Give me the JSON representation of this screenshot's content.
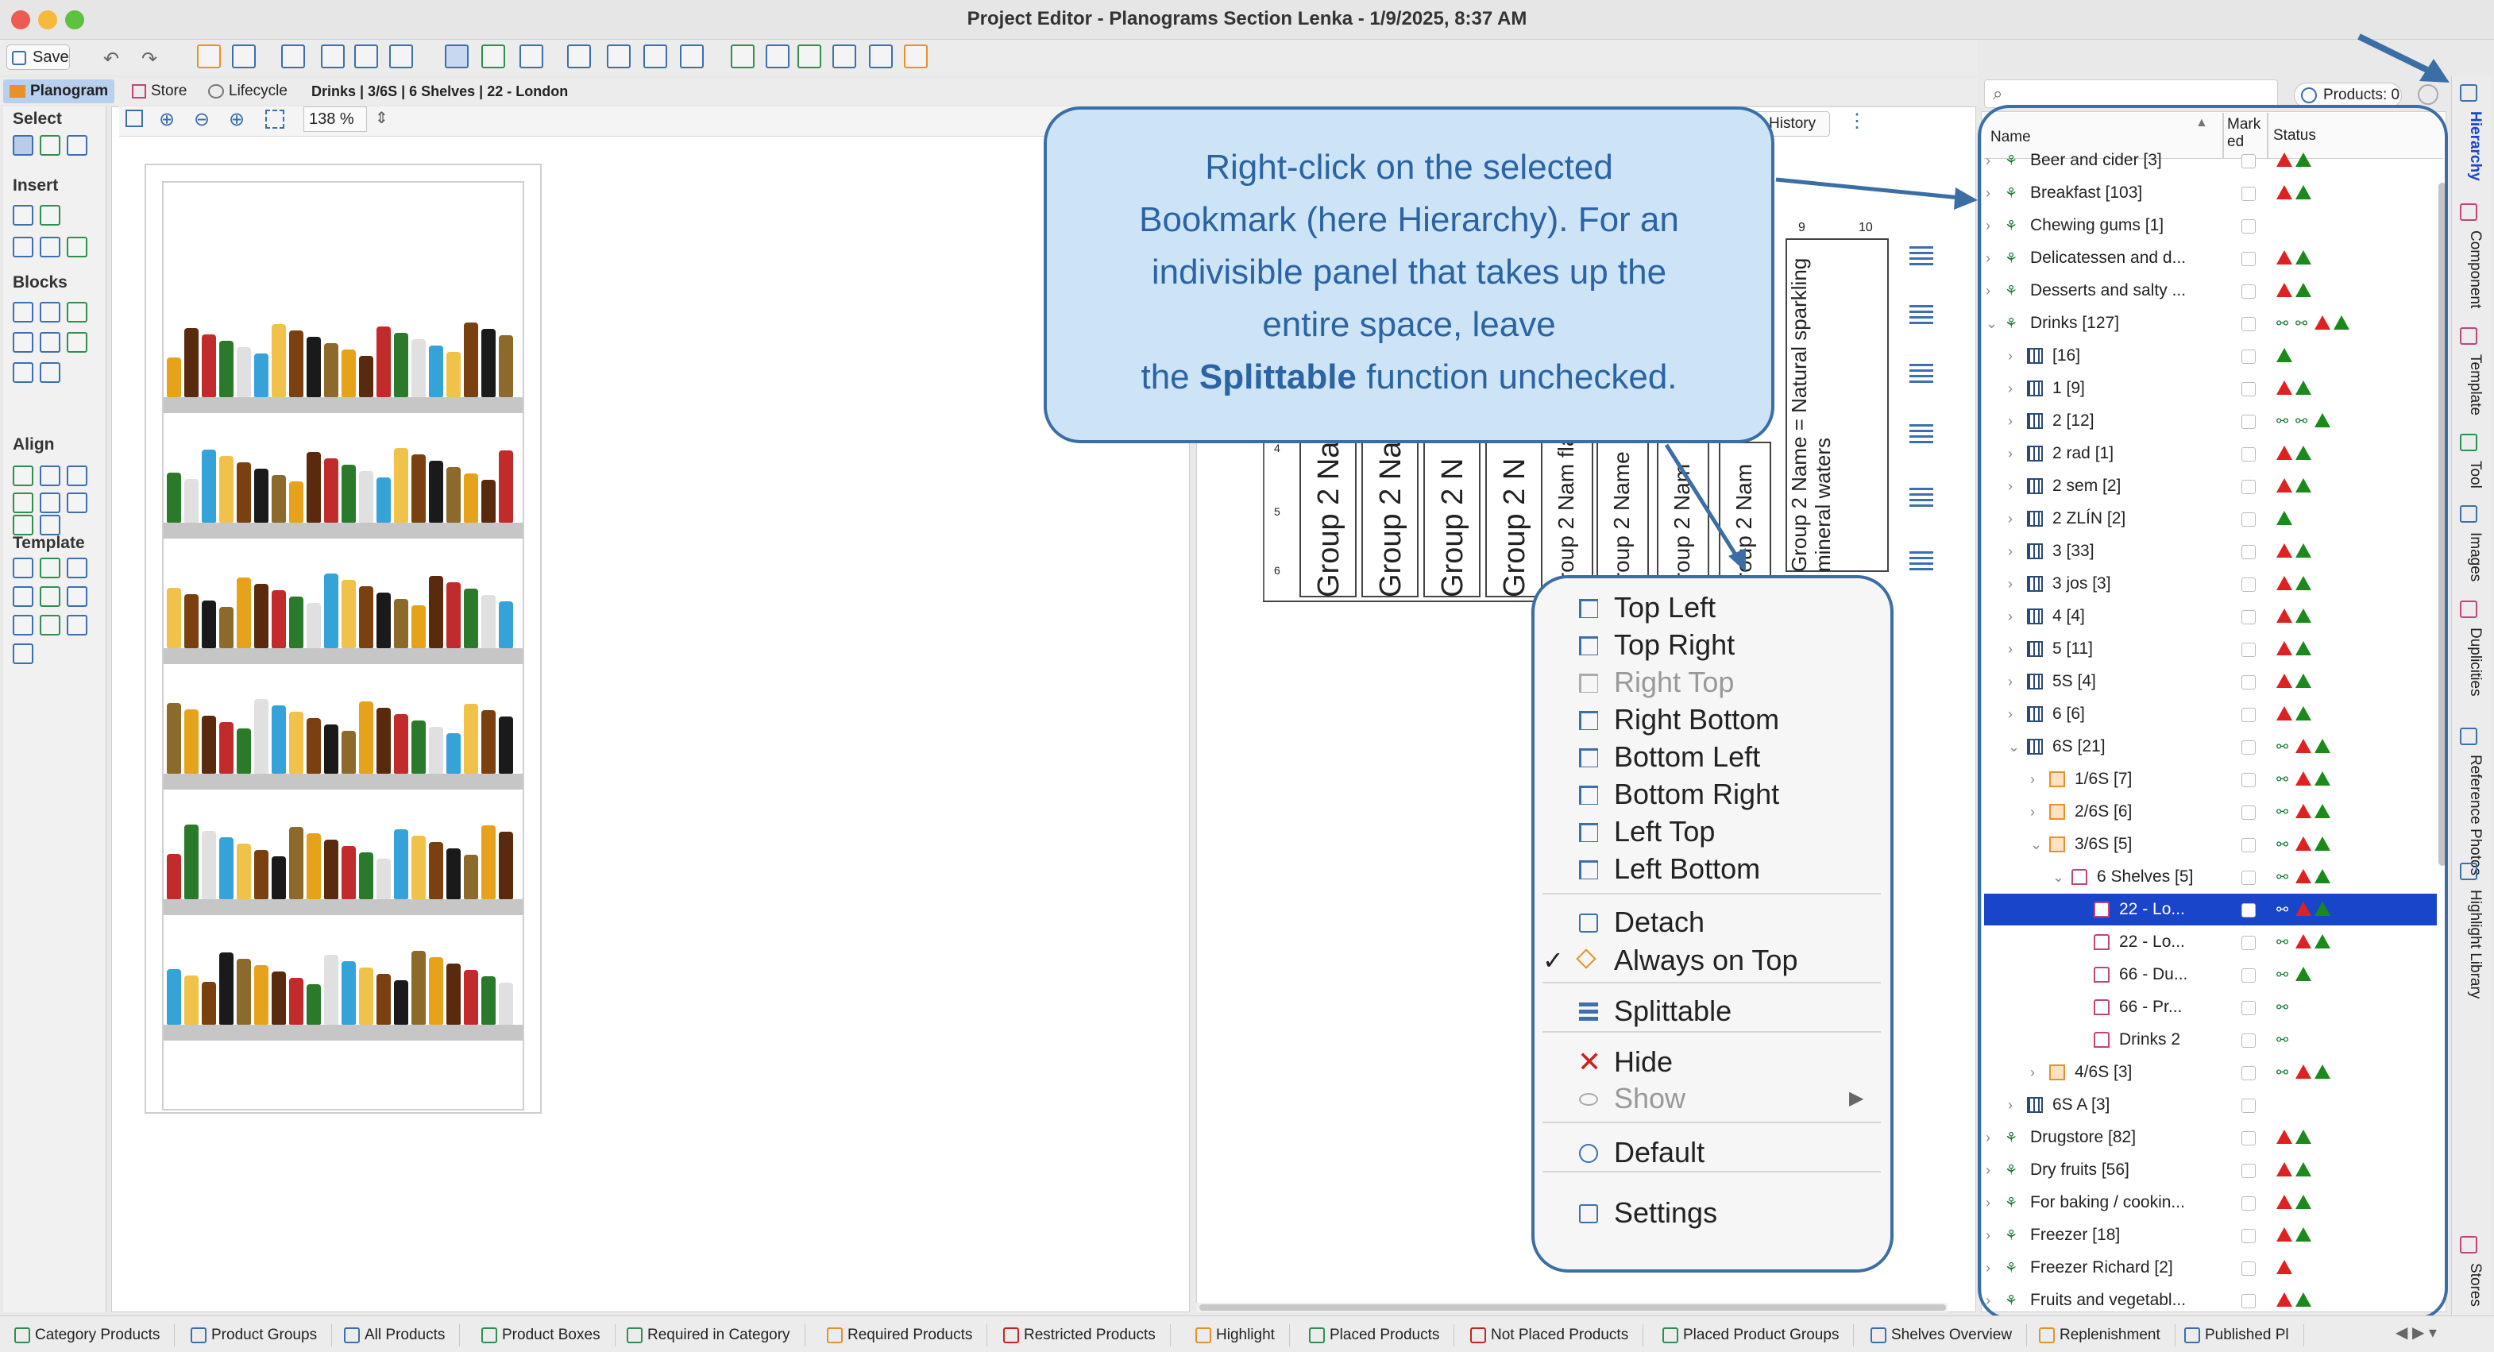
{
  "window": {
    "title": "Project Editor - Planograms Section Lenka - 1/9/2025, 8:37 AM"
  },
  "toolbar": {
    "save_label": "Save"
  },
  "tabs": {
    "planogram": "Planogram",
    "store": "Store",
    "lifecycle": "Lifecycle",
    "breadcrumb": "Drinks | 3/6S | 6 Shelves | 22 - London"
  },
  "palette": {
    "select": "Select",
    "insert": "Insert",
    "blocks": "Blocks",
    "align": "Align",
    "template": "Template"
  },
  "canvas": {
    "zoom": "138 %",
    "history_label": "History"
  },
  "planogram": {
    "columns": [
      "Group 2 Nam",
      "Group 2 Na",
      "Group 2 N",
      "Group 2 N",
      "Group 2 Nam flavo",
      "Group 2 Name",
      "Group 2 Nam",
      "Group 2 Nam",
      "Group 2 Name = Natural sparkling mineral waters"
    ],
    "ruler_labels": [
      "9",
      "10"
    ],
    "row_labels": [
      "4",
      "5",
      "6"
    ]
  },
  "callout": {
    "line1": "Right-click on the selected",
    "line2": "Bookmark (here Hierarchy). For an",
    "line3": "indivisible panel that takes up the",
    "line4": "entire space, leave",
    "line5_pre": "the ",
    "line5_bold": "Splittable",
    "line5_post": " function unchecked."
  },
  "context_menu": {
    "items": [
      {
        "label": "Top Left",
        "disabled": false
      },
      {
        "label": "Top Right",
        "disabled": false
      },
      {
        "label": "Right Top",
        "disabled": true
      },
      {
        "label": "Right Bottom",
        "disabled": false
      },
      {
        "label": "Bottom Left",
        "disabled": false
      },
      {
        "label": "Bottom Right",
        "disabled": false
      },
      {
        "label": "Left Top",
        "disabled": false
      },
      {
        "label": "Left Bottom",
        "disabled": false
      }
    ],
    "detach": "Detach",
    "always_on_top": "Always on Top",
    "always_on_top_checked": true,
    "splittable": "Splittable",
    "hide": "Hide",
    "show": "Show",
    "default": "Default",
    "settings": "Settings"
  },
  "tree": {
    "search_placeholder": "",
    "products_label": "Products: 0",
    "header": {
      "name": "Name",
      "marked": "Mark ed",
      "status": "Status"
    },
    "rows": [
      {
        "label": "Beer and cider [3]",
        "icon": "group",
        "status": "rg"
      },
      {
        "label": "Breakfast [103]",
        "icon": "group",
        "status": "rg"
      },
      {
        "label": "Chewing gums [1]",
        "icon": "group",
        "status": ""
      },
      {
        "label": "Delicatessen and d...",
        "icon": "group",
        "status": "rg"
      },
      {
        "label": "Desserts and salty ...",
        "icon": "group",
        "status": "rg"
      },
      {
        "label": "Drinks [127]",
        "icon": "group",
        "status": "bbrg"
      },
      {
        "label": "[16]",
        "icon": "grid",
        "status": "g"
      },
      {
        "label": "1 [9]",
        "icon": "grid",
        "status": "rg"
      },
      {
        "label": "2 [12]",
        "icon": "grid",
        "status": "bbg"
      },
      {
        "label": "2 rad [1]",
        "icon": "grid",
        "status": "rg"
      },
      {
        "label": "2 sem [2]",
        "icon": "grid",
        "status": "rg"
      },
      {
        "label": "2 ZLÍN [2]",
        "icon": "grid",
        "status": "g"
      },
      {
        "label": "3 [33]",
        "icon": "grid",
        "status": "rg"
      },
      {
        "label": "3 jos [3]",
        "icon": "grid",
        "status": "rg"
      },
      {
        "label": "4 [4]",
        "icon": "grid",
        "status": "rg"
      },
      {
        "label": "5 [11]",
        "icon": "grid",
        "status": "rg"
      },
      {
        "label": "5S [4]",
        "icon": "grid",
        "status": "rg"
      },
      {
        "label": "6 [6]",
        "icon": "grid",
        "status": "rg"
      },
      {
        "label": "6S [21]",
        "icon": "grid",
        "status": "brg"
      },
      {
        "label": "1/6S [7]",
        "icon": "orange",
        "status": "brg"
      },
      {
        "label": "2/6S [6]",
        "icon": "orange",
        "status": "brg"
      },
      {
        "label": "3/6S [5]",
        "icon": "orange",
        "status": "brg"
      },
      {
        "label": "6 Shelves [5]",
        "icon": "pink",
        "status": "brg"
      },
      {
        "label": "22 - Lo...",
        "icon": "pink",
        "status": "brg"
      },
      {
        "label": "22 - Lo...",
        "icon": "pink",
        "status": "brg"
      },
      {
        "label": "66 - Du...",
        "icon": "pink",
        "status": "bg"
      },
      {
        "label": "66 - Pr...",
        "icon": "pink",
        "status": "b"
      },
      {
        "label": "Drinks 2",
        "icon": "pink",
        "status": "b"
      },
      {
        "label": "4/6S [3]",
        "icon": "orange",
        "status": "brg"
      },
      {
        "label": "6S A [3]",
        "icon": "grid",
        "status": ""
      },
      {
        "label": "Drugstore [82]",
        "icon": "group",
        "status": "rg"
      },
      {
        "label": "Dry fruits [56]",
        "icon": "group",
        "status": "rg"
      },
      {
        "label": "For baking / cookin...",
        "icon": "group",
        "status": "rg"
      },
      {
        "label": "Freezer [18]",
        "icon": "group",
        "status": "rg"
      },
      {
        "label": "Freezer Richard [2]",
        "icon": "group",
        "status": "r"
      },
      {
        "label": "Fruits and vegetabl...",
        "icon": "group",
        "status": "rg"
      }
    ]
  },
  "side_tabs": [
    "Hierarchy",
    "Component",
    "Template",
    "Tool",
    "Images",
    "Duplicities",
    "Reference Photos",
    "Highlight Library",
    "Stores"
  ],
  "bottom_tabs": [
    "Category Products",
    "Product Groups",
    "All Products",
    "Product Boxes",
    "Required in Category",
    "Required Products",
    "Restricted Products",
    "Highlight",
    "Placed Products",
    "Not Placed Products",
    "Placed Product Groups",
    "Shelves Overview",
    "Replenishment",
    "Published Pl"
  ],
  "colors": {
    "callout_border": "#3c6ea6",
    "callout_fill": "#cde4f7",
    "callout_text": "#2b63a3",
    "selection": "#1845c9",
    "status_red": "#d22222",
    "status_green": "#1b8a1b",
    "status_blue": "#2030c8"
  }
}
